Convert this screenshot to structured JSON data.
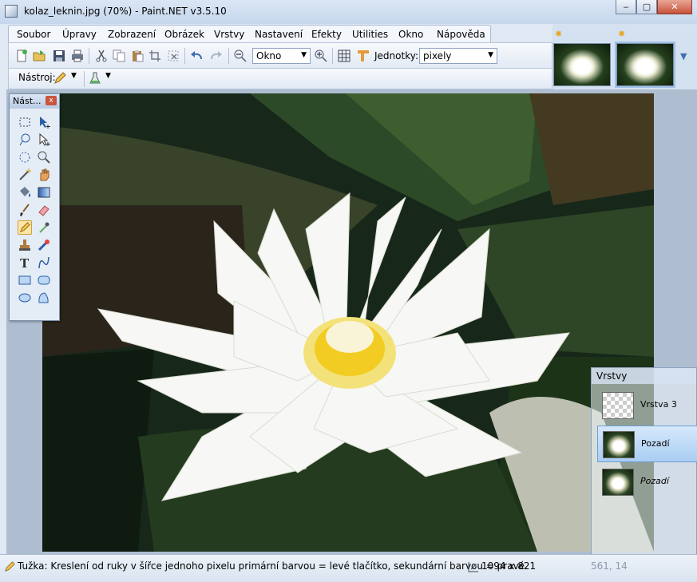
{
  "window": {
    "title": "kolaz_leknin.jpg (70%) - Paint.NET v3.5.10",
    "buttons": {
      "minimize": "‒",
      "maximize": "▢",
      "close": "✕"
    }
  },
  "menu": [
    "Soubor",
    "Úpravy",
    "Zobrazení",
    "Obrázek",
    "Vrstvy",
    "Nastavení",
    "Efekty",
    "Utilities",
    "Okno",
    "Nápověda"
  ],
  "toolbar": {
    "zoom_value": "Okno",
    "units_label": "Jednotky:",
    "units_value": "pixely",
    "tool_label": "Nástroj:"
  },
  "tools_window": {
    "title": "Nást...",
    "close": "x"
  },
  "layers_window": {
    "title": "Vrstvy",
    "layers": [
      {
        "name": "Vrstva 3",
        "selected": false,
        "italic": false
      },
      {
        "name": "Pozadí",
        "selected": true,
        "italic": false
      },
      {
        "name": "Pozadí",
        "selected": false,
        "italic": true
      }
    ]
  },
  "status": {
    "text": "Tužka: Kreslení od ruky v šířce jednoho pixelu primární barvou = levé tlačítko, sekundární barvou = pravé.",
    "image_size": "1094 x 821",
    "coords": "561, 14"
  },
  "colors": {
    "accent": "#3d6fb3",
    "selected_tool": "#fbe6a5"
  }
}
